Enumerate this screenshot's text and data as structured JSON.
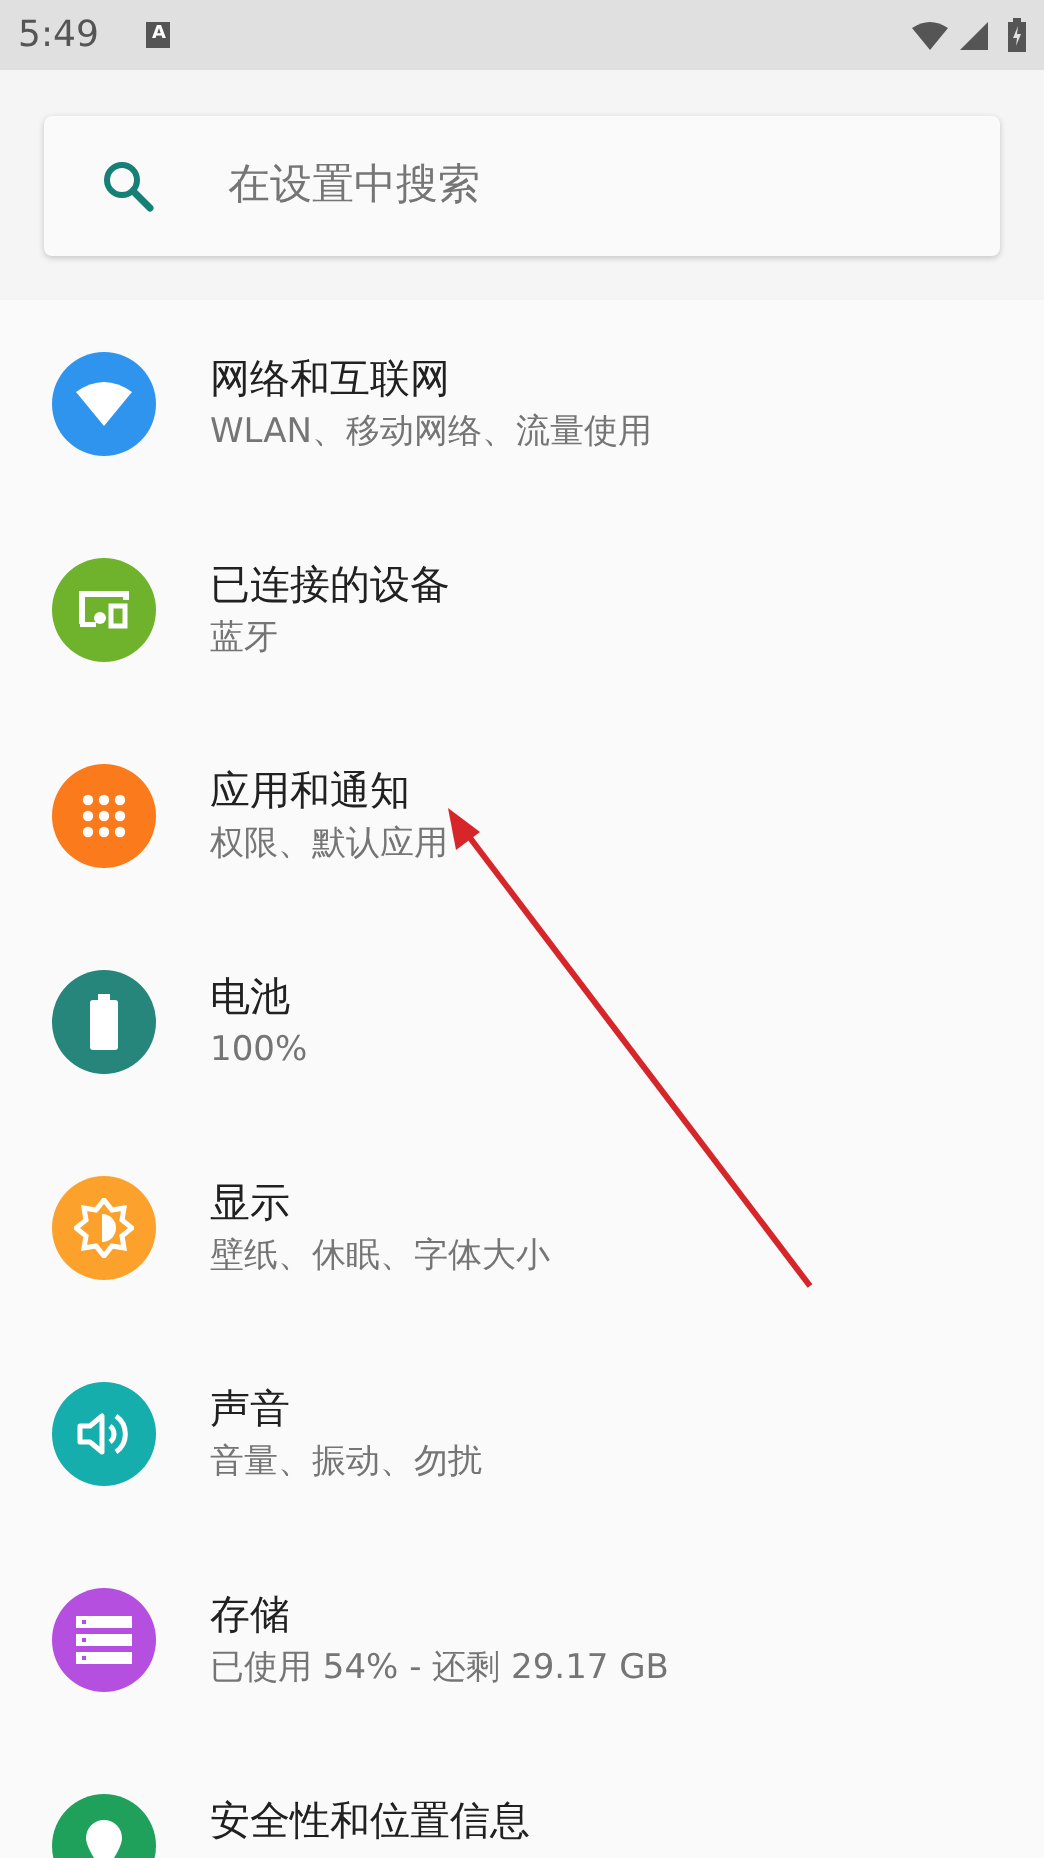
{
  "status_bar": {
    "time": "5:49",
    "notification": "A"
  },
  "search": {
    "placeholder": "在设置中搜索"
  },
  "items": [
    {
      "kind": "network",
      "color": "#2f94ee",
      "title": "网络和互联网",
      "subtitle": "WLAN、移动网络、流量使用"
    },
    {
      "kind": "devices",
      "color": "#6fb22b",
      "title": "已连接的设备",
      "subtitle": "蓝牙"
    },
    {
      "kind": "apps",
      "color": "#fb7b1c",
      "title": "应用和通知",
      "subtitle": "权限、默认应用"
    },
    {
      "kind": "battery",
      "color": "#27867b",
      "title": "电池",
      "subtitle": "100%"
    },
    {
      "kind": "display",
      "color": "#fca22c",
      "title": "显示",
      "subtitle": "壁纸、休眠、字体大小"
    },
    {
      "kind": "sound",
      "color": "#16aeac",
      "title": "声音",
      "subtitle": "音量、振动、勿扰"
    },
    {
      "kind": "storage",
      "color": "#b44fdf",
      "title": "存储",
      "subtitle": "已使用 54% - 还剩 29.17 GB"
    },
    {
      "kind": "security",
      "color": "#1fa05b",
      "title": "安全性和位置信息"
    }
  ]
}
